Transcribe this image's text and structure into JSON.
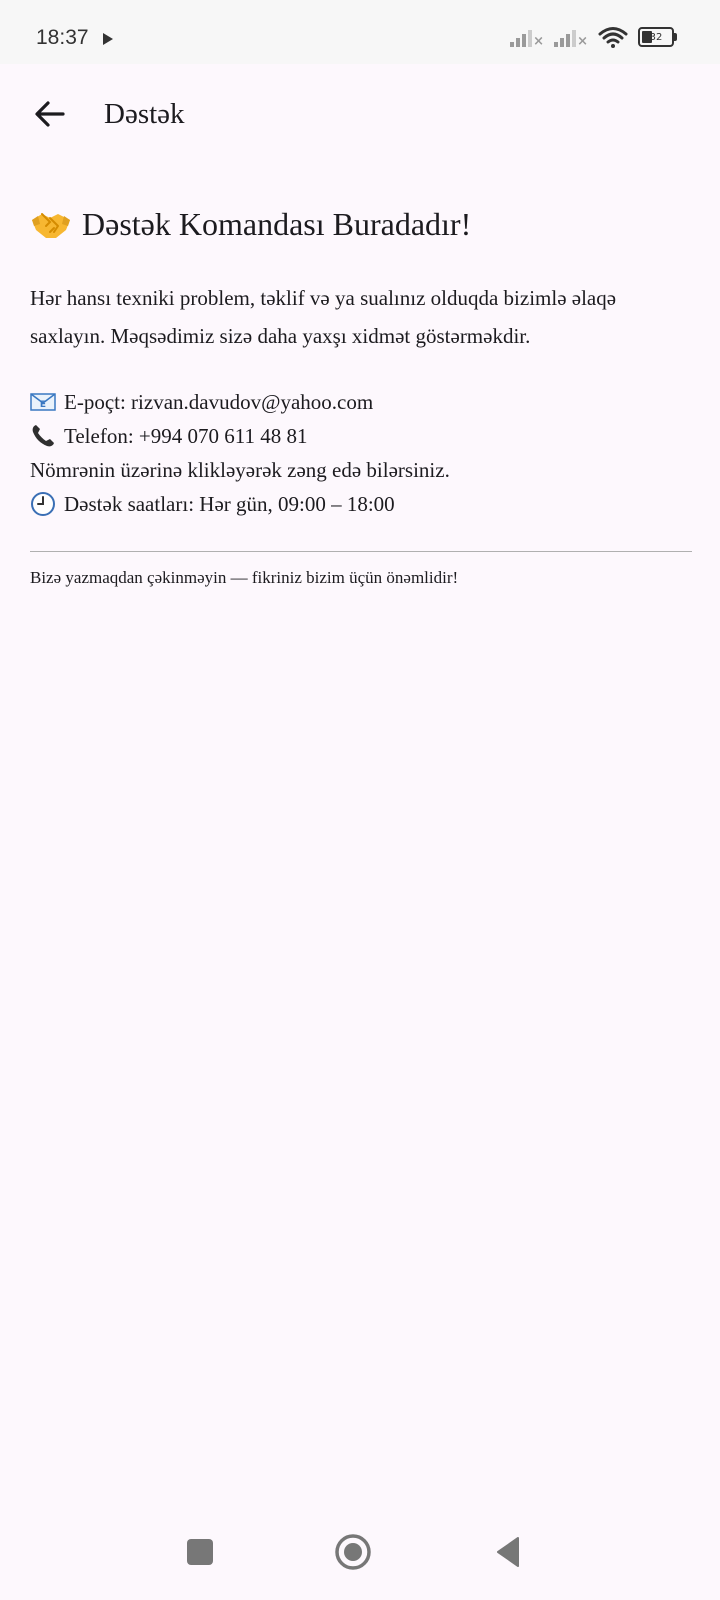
{
  "status_bar": {
    "time": "18:37",
    "battery_level": "32"
  },
  "app_bar": {
    "title": "Dəstək",
    "back_icon": "arrow-left-icon"
  },
  "main": {
    "heading": "Dəstək Komandası Buradadır!",
    "heading_icon": "handshake-icon",
    "intro": "Hər hansı texniki problem, təklif və ya sualınız olduqda bizimlə əlaqə saxlayın. Məqsədimiz sizə daha yaxşı xidmət göstərməkdir.",
    "email_label": "E-poçt: rizvan.davudov@yahoo.com",
    "email_icon": "email-icon",
    "phone_label": "Telefon: +994 070 611 48 81",
    "phone_icon": "phone-icon",
    "phone_hint": "Nömrənin üzərinə klikləyərək zəng edə bilərsiniz.",
    "hours_label": "Dəstək saatları: Hər gün, 09:00 – 18:00",
    "hours_icon": "clock-icon",
    "footer_note": "Bizə yazmaqdan çəkinməyin — fikriniz bizim üçün önəmlidir!"
  },
  "nav_bar": {
    "recents_icon": "square-icon",
    "home_icon": "circle-home-icon",
    "back_icon": "triangle-back-icon"
  }
}
